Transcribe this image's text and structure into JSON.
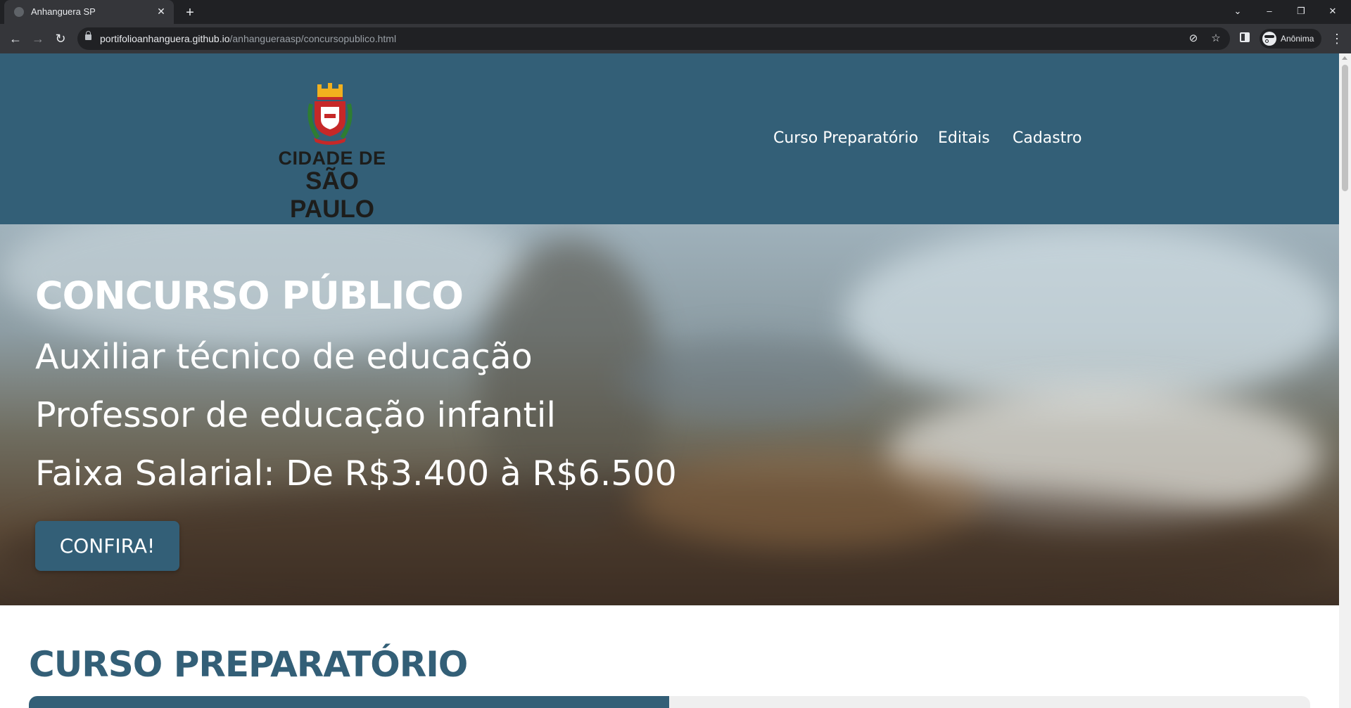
{
  "browser": {
    "tab_title": "Anhanguera SP",
    "tab_close": "✕",
    "new_tab": "+",
    "url_host": "portifolioanhanguera.github.io",
    "url_path": "/anhangueraasp/concursopublico.html",
    "profile_label": "Anônima",
    "controls": {
      "tab_search": "⌄",
      "minimize": "–",
      "restore": "❐",
      "close": "✕"
    },
    "nav": {
      "back": "←",
      "forward": "→",
      "reload": "↻",
      "menu": "⋮",
      "eye_off": "⊘",
      "star": "☆"
    }
  },
  "site": {
    "logo": {
      "line1": "CIDADE DE",
      "line2": "SÃO PAULO"
    },
    "nav": [
      "Curso Preparatório",
      "Editais",
      "Cadastro"
    ]
  },
  "hero": {
    "title": "CONCURSO PÚBLICO",
    "line1": "Auxiliar técnico de educação",
    "line2": "Professor de educação infantil",
    "line3": "Faixa Salarial: De R$3.400 à R$6.500",
    "cta": "CONFIRA!"
  },
  "section": {
    "title": "CURSO PREPARATÓRIO"
  },
  "colors": {
    "brand": "#335f77",
    "chrome_dark": "#202124",
    "chrome_mid": "#35363a"
  }
}
